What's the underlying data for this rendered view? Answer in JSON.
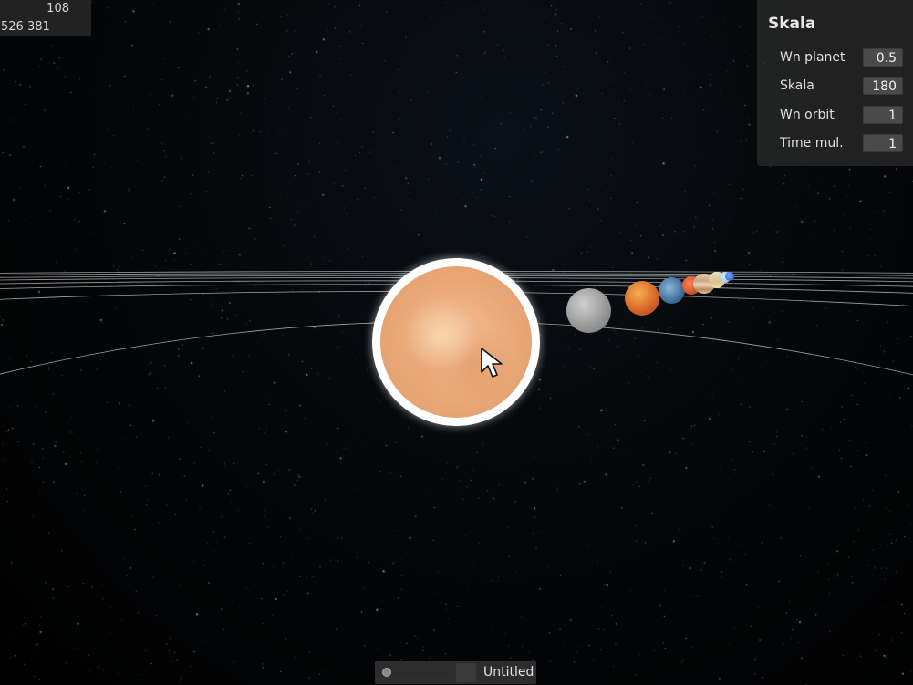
{
  "stats": {
    "fps": "108",
    "memory": "526 381"
  },
  "panel": {
    "title": "Skala",
    "fields": [
      {
        "label": "Wn planet",
        "value": "0.5"
      },
      {
        "label": "Skala",
        "value": "180"
      },
      {
        "label": "Wn orbit",
        "value": "1"
      },
      {
        "label": "Time mul.",
        "value": "1"
      }
    ]
  },
  "bottombar": {
    "title": "Untitled"
  },
  "bodies": [
    "sun",
    "mercury",
    "venus",
    "earth",
    "mars",
    "jupiter",
    "saturn",
    "uranus",
    "neptune"
  ],
  "colors": {
    "space": "#000000",
    "panel": "#262626",
    "sun": "#eaa878",
    "orbit": "#c8c8c8"
  },
  "icons": {
    "cursor": "arrow-cursor-icon",
    "slider": "slider-knob-icon"
  }
}
